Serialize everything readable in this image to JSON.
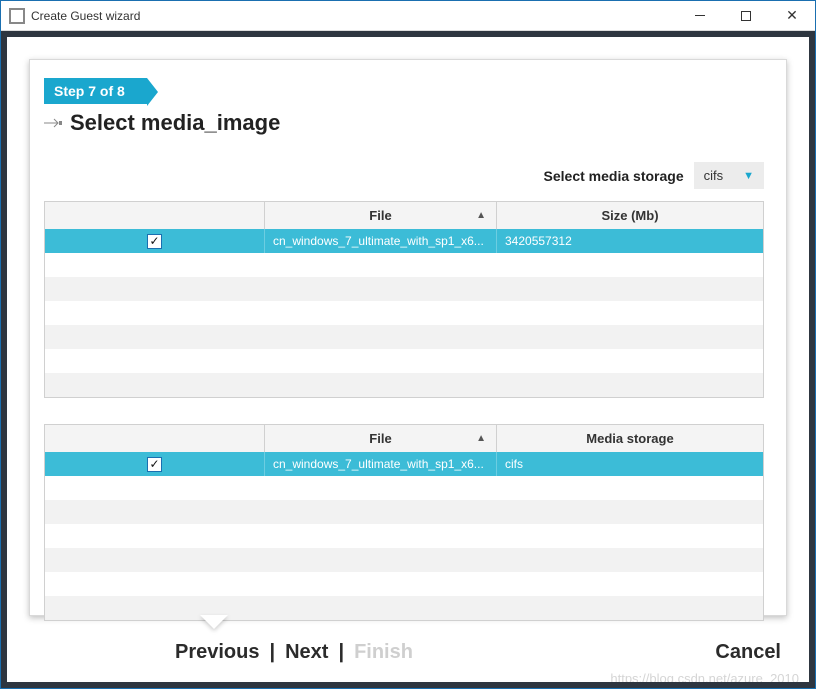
{
  "window": {
    "title": "Create Guest wizard"
  },
  "step": {
    "badge": "Step 7 of 8",
    "heading": "Select media_image"
  },
  "storage": {
    "label": "Select media storage",
    "value": "cifs"
  },
  "table1": {
    "headers": {
      "file": "File",
      "size": "Size (Mb)"
    },
    "rows": [
      {
        "checked": true,
        "file": "cn_windows_7_ultimate_with_sp1_x6...",
        "size": "3420557312"
      }
    ]
  },
  "table2": {
    "headers": {
      "file": "File",
      "mstorage": "Media storage"
    },
    "rows": [
      {
        "checked": true,
        "file": "cn_windows_7_ultimate_with_sp1_x6...",
        "mstorage": "cifs"
      }
    ]
  },
  "nav": {
    "previous": "Previous",
    "next": "Next",
    "finish": "Finish",
    "cancel": "Cancel"
  },
  "watermark": "https://blog.csdn.net/azure_2010"
}
